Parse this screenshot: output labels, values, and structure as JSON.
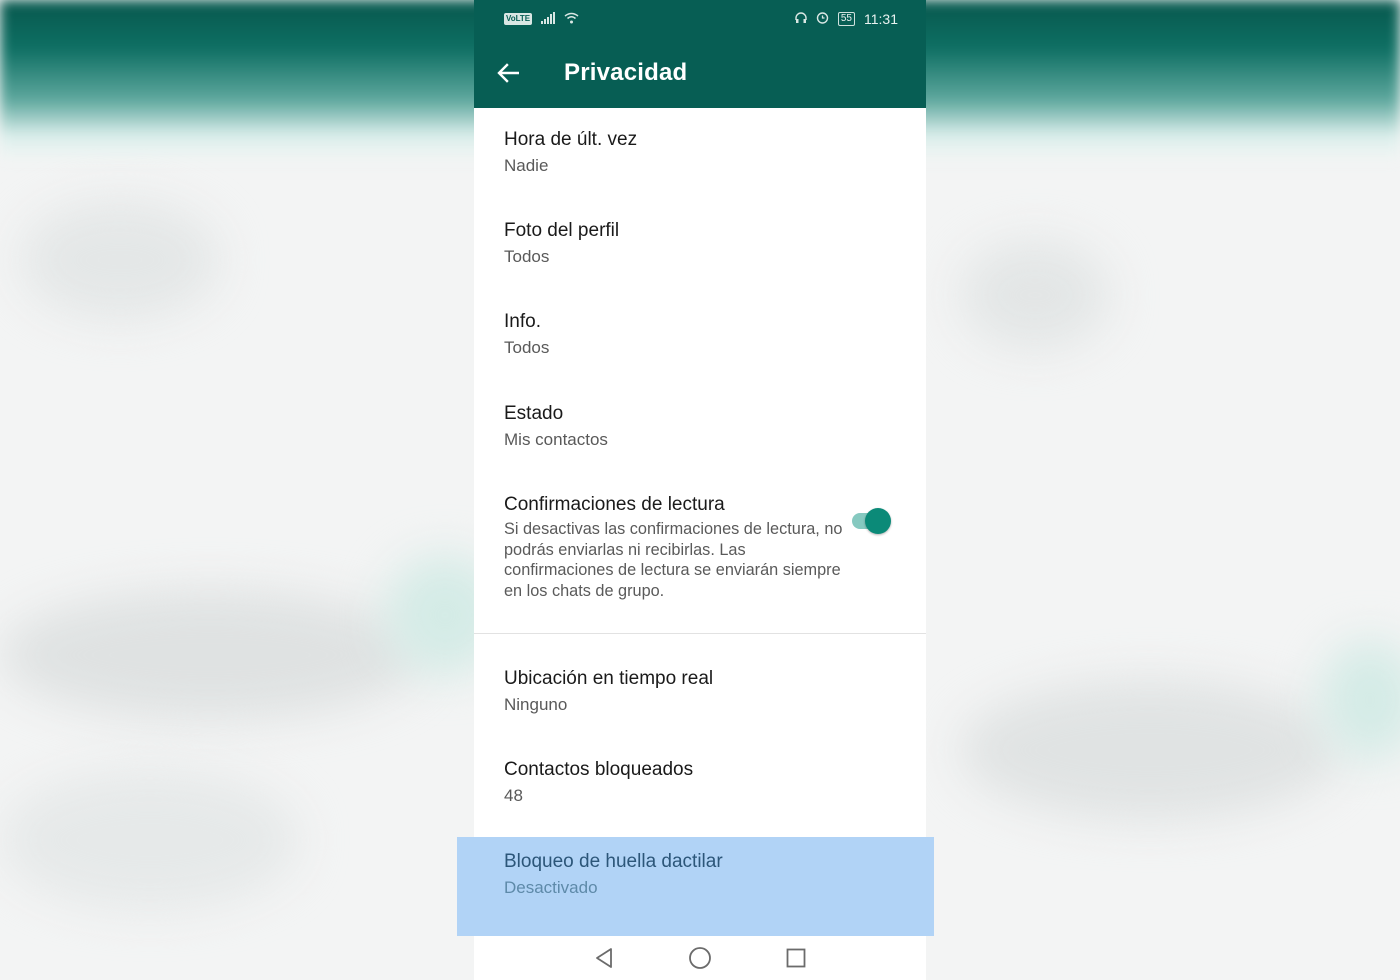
{
  "status_bar": {
    "network_badge": "VoLTE",
    "battery_level": "55",
    "time": "11:31",
    "icons": [
      "signal-icon",
      "wifi-icon",
      "headphones-icon",
      "alarm-icon",
      "battery-icon"
    ]
  },
  "app_bar": {
    "title": "Privacidad",
    "back_icon": "arrow-left-icon"
  },
  "settings": [
    {
      "title": "Hora de últ. vez",
      "value": "Nadie"
    },
    {
      "title": "Foto del perfil",
      "value": "Todos"
    },
    {
      "title": "Info.",
      "value": "Todos"
    },
    {
      "title": "Estado",
      "value": "Mis contactos"
    },
    {
      "title": "Confirmaciones de lectura",
      "description": "Si desactivas las confirmaciones de lectura, no podrás enviarlas ni recibirlas. Las confirmaciones de lectura se enviarán siempre en los chats de grupo.",
      "enabled": true
    },
    {
      "title": "Ubicación en tiempo real",
      "value": "Ninguno"
    },
    {
      "title": "Contactos bloqueados",
      "value": "48"
    },
    {
      "title": "Bloqueo de huella dactilar",
      "value": "Desactivado",
      "highlighted": true
    }
  ],
  "nav_bar": {
    "icons": [
      "back-triangle-icon",
      "home-circle-icon",
      "recents-square-icon"
    ]
  },
  "colors": {
    "primary": "#075e54",
    "accent": "#0b8a78",
    "highlight": "#b1d3f6"
  }
}
